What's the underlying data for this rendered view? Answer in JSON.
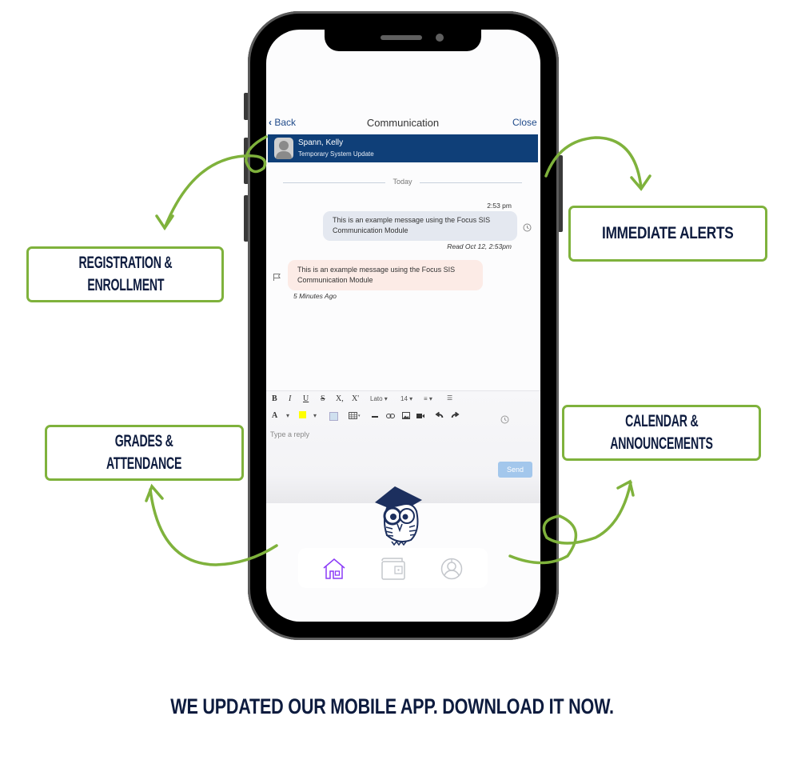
{
  "app": {
    "nav": {
      "back_label": "Back",
      "title": "Communication",
      "close_label": "Close"
    },
    "conversation": {
      "name": "Spann, Kelly",
      "subject": "Temporary System Update"
    },
    "day_divider": "Today",
    "messages": [
      {
        "direction": "outgoing",
        "time": "2:53 pm",
        "text_line1": "This is an example message using the Focus SIS",
        "text_line2": "Communication Module",
        "receipt": "Read Oct 12, 2:53pm"
      },
      {
        "direction": "incoming",
        "text_line1": "This is an example message using the Focus SIS",
        "text_line2": "Communication Module",
        "age": "5 Minutes Ago"
      }
    ],
    "editor": {
      "toolbar_row1": [
        "B",
        "I",
        "U",
        "S",
        "X,",
        "X'"
      ],
      "font_select": "Lato ▾",
      "size_select": "14 ▾",
      "align_select": "≡ ▾",
      "list_icon": "☰",
      "text_color": "A",
      "highlight_color": "#ffff00",
      "reply_placeholder": "Type a reply",
      "send_label": "Send"
    },
    "tabbar": {
      "items": [
        {
          "name": "home",
          "active": true,
          "color": "#8b3cf7"
        },
        {
          "name": "wallet",
          "active": false,
          "color": "#c4c7cc"
        },
        {
          "name": "profile",
          "active": false,
          "color": "#c4c7cc"
        }
      ]
    }
  },
  "features": {
    "registration": {
      "line1": "REGISTRATION &",
      "line2": "ENROLLMENT"
    },
    "alerts": {
      "line1": "IMMEDIATE ALERTS"
    },
    "grades": {
      "line1": "GRADES &",
      "line2": "ATTENDANCE"
    },
    "calendar": {
      "line1": "CALENDAR &",
      "line2": "ANNOUNCEMENTS"
    }
  },
  "footer": {
    "headline": "WE UPDATED OUR MOBILE APP. DOWNLOAD IT NOW."
  },
  "colors": {
    "accent_green": "#7fb23c",
    "navy": "#0d1b3e",
    "header_blue": "#0f3f78"
  }
}
